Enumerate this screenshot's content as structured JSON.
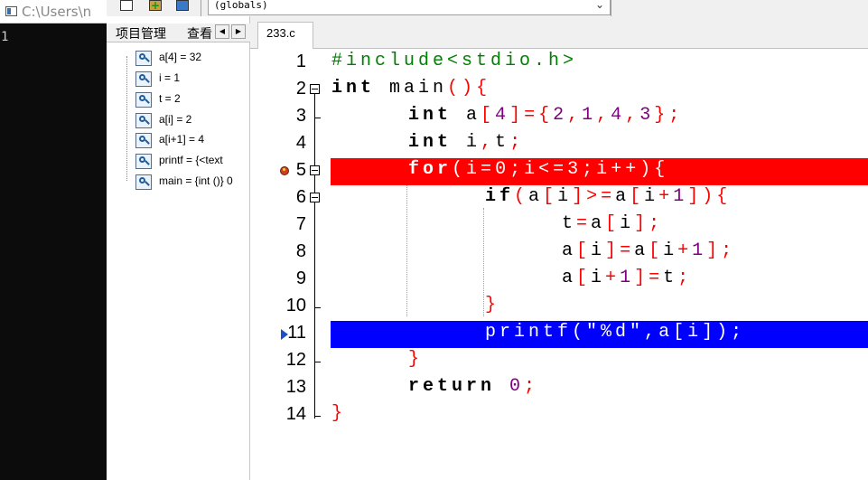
{
  "console": {
    "title": "C:\\Users\\n",
    "output": "1"
  },
  "toolbar": {
    "scope_value": "(globals)"
  },
  "left_panel": {
    "tabs": [
      "项目管理",
      "查看"
    ],
    "watches": [
      "a[4] = 32",
      "i = 1",
      "t = 2",
      "a[i] = 2",
      "a[i+1] = 4",
      "printf = {<text",
      "main = {int ()} 0"
    ]
  },
  "editor": {
    "file_tab": "233.c",
    "breakpoint_line": 5,
    "execution_line": 11,
    "colors": {
      "breakpoint_highlight": "#ff0000",
      "execution_highlight": "#0000ff",
      "keyword": "#000000",
      "number": "#800080",
      "operator": "#ff0000",
      "preprocessor": "#008000"
    },
    "lines": [
      {
        "n": "1",
        "text": "#include<stdio.h>"
      },
      {
        "n": "2",
        "text": "int main(){"
      },
      {
        "n": "3",
        "text": "int a[4]={2,1,4,3};"
      },
      {
        "n": "4",
        "text": "int i,t;"
      },
      {
        "n": "5",
        "text": "for(i=0;i<=3;i++){"
      },
      {
        "n": "6",
        "text": "if(a[i]>=a[i+1]){"
      },
      {
        "n": "7",
        "text": "t=a[i];"
      },
      {
        "n": "8",
        "text": "a[i]=a[i+1];"
      },
      {
        "n": "9",
        "text": "a[i+1]=t;"
      },
      {
        "n": "10",
        "text": "}"
      },
      {
        "n": "11",
        "text": "printf(\"%d\",a[i]);"
      },
      {
        "n": "12",
        "text": "}"
      },
      {
        "n": "13",
        "text": "return 0;"
      },
      {
        "n": "14",
        "text": "}"
      }
    ]
  }
}
